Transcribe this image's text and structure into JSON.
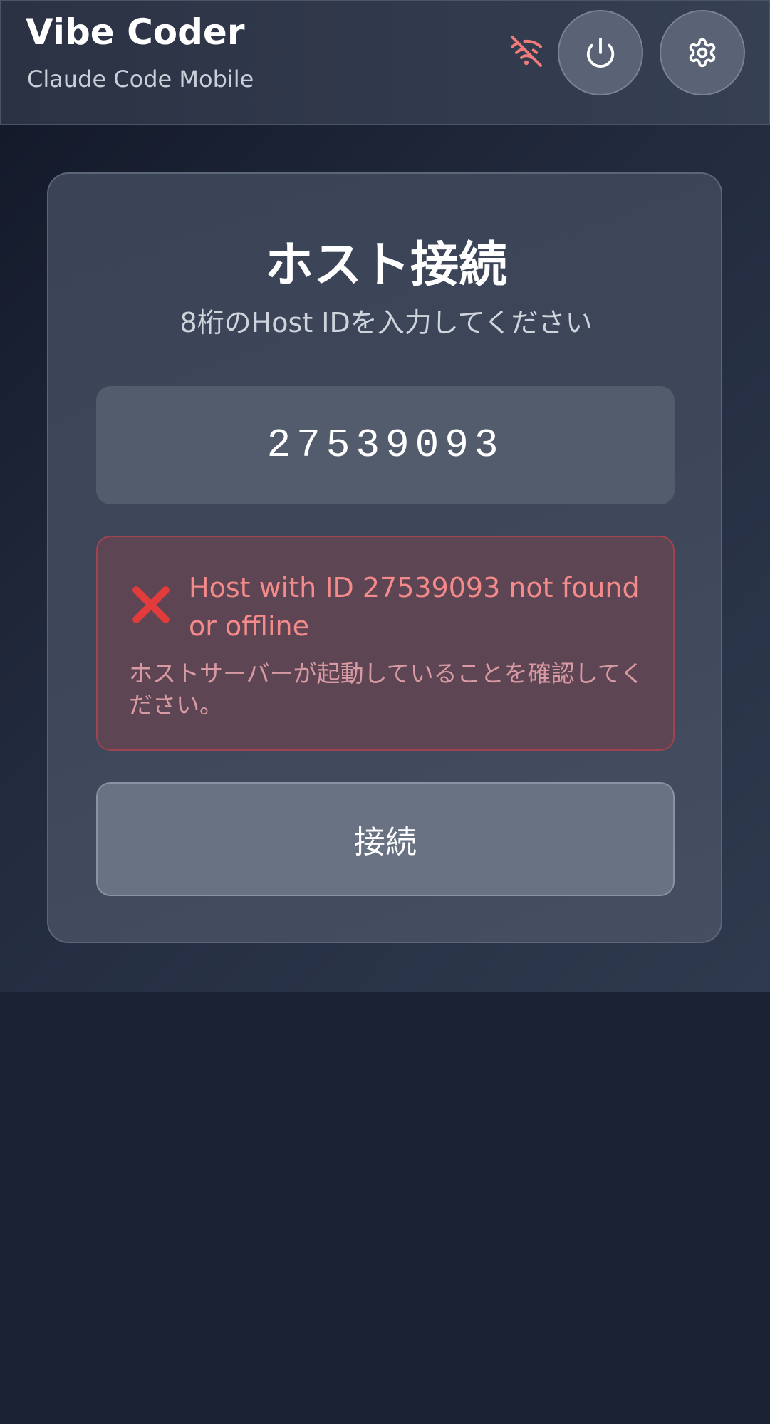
{
  "header": {
    "title": "Vibe Coder",
    "subtitle": "Claude Code Mobile",
    "status_icon": "wifi-off-icon",
    "power_icon": "power-icon",
    "settings_icon": "gear-icon"
  },
  "connect": {
    "title": "ホスト接続",
    "subtitle": "8桁のHost IDを入力してください",
    "host_id_value": "27539093",
    "error_icon": "error-x-icon",
    "error_message": "Host with ID 27539093 not found or offline",
    "error_hint": "ホストサーバーが起動していることを確認してください。",
    "button_label": "接続"
  },
  "colors": {
    "error": "#f58a8a",
    "wifi_off": "#f07b7b",
    "accent_card": "#3d4759"
  }
}
